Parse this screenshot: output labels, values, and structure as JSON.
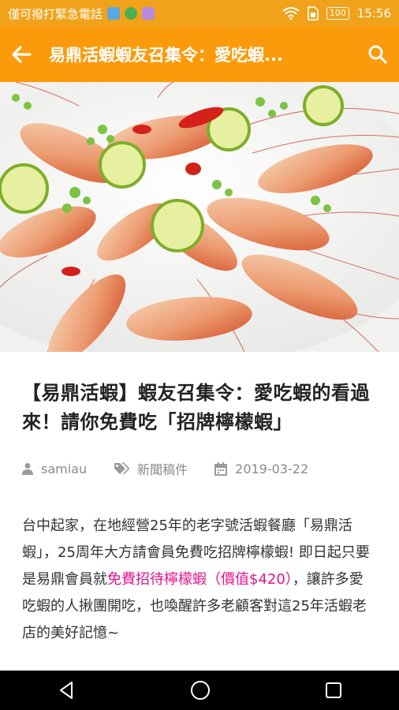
{
  "status_bar": {
    "carrier_text": "僅可撥打緊急電話",
    "battery": "100",
    "time": "15:56",
    "icons": [
      "photo-icon",
      "chrome-icon",
      "app-icon",
      "wifi-icon",
      "sim-icon",
      "battery-icon"
    ]
  },
  "app_bar": {
    "title": "易鼎活蝦蝦友召集令：愛吃蝦...",
    "back_icon": "back-arrow-icon",
    "search_icon": "search-icon",
    "bg_color": "#fb9a0a"
  },
  "article": {
    "title": "【易鼎活蝦】蝦友召集令：愛吃蝦的看過來！請你免費吃「招牌檸檬蝦」",
    "author": "samiau",
    "category": "新聞稿件",
    "date": "2019-03-22",
    "body_part1": "台中起家，在地經營25年的老字號活蝦餐廳「易鼎活蝦」，25周年大方請會員免費吃招牌檸檬蝦! 即日起只要是易鼎會員就",
    "body_highlight": "免費招待檸檬蝦（價值$420）",
    "body_part2": "，讓許多愛吃蝦的人揪團開吃，也喚醒許多老顧客對這25年活蝦老店的美好記憶~",
    "highlight_color": "#e0158a"
  },
  "nav_bar": {
    "back": "nav-back-icon",
    "home": "nav-home-icon",
    "recents": "nav-recents-icon"
  }
}
